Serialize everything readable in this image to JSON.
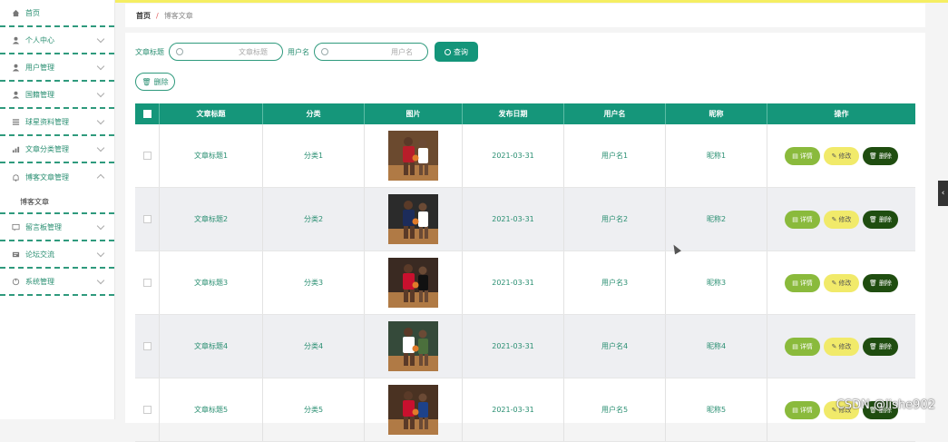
{
  "sidebar": {
    "items": [
      {
        "label": "首页",
        "icon": "home-icon",
        "expandable": false
      },
      {
        "label": "个人中心",
        "icon": "user-icon",
        "expandable": true
      },
      {
        "label": "用户管理",
        "icon": "user-icon",
        "expandable": true
      },
      {
        "label": "国籍管理",
        "icon": "user-icon",
        "expandable": true
      },
      {
        "label": "球星资料管理",
        "icon": "list-icon",
        "expandable": true
      },
      {
        "label": "文章分类管理",
        "icon": "chart-icon",
        "expandable": true
      },
      {
        "label": "博客文章管理",
        "icon": "bell-icon",
        "expandable": true,
        "expanded": true,
        "sub": "博客文章"
      },
      {
        "label": "留言板管理",
        "icon": "message-icon",
        "expandable": true
      },
      {
        "label": "论坛交流",
        "icon": "forum-icon",
        "expandable": true
      },
      {
        "label": "系统管理",
        "icon": "settings-icon",
        "expandable": true
      }
    ]
  },
  "breadcrumb": {
    "home": "首页",
    "separator": "/",
    "current": "博客文章"
  },
  "search": {
    "title_label": "文章标题",
    "title_placeholder": "文章标题",
    "user_label": "用户名",
    "user_placeholder": "用户名",
    "query_button": "查询"
  },
  "delete_button": "删除",
  "table": {
    "headers": [
      "文章标题",
      "分类",
      "图片",
      "发布日期",
      "用户名",
      "昵称",
      "操作"
    ],
    "rows": [
      {
        "title": "文章标题1",
        "category": "分类1",
        "date": "2021-03-31",
        "user": "用户名1",
        "nickname": "昵称1"
      },
      {
        "title": "文章标题2",
        "category": "分类2",
        "date": "2021-03-31",
        "user": "用户名2",
        "nickname": "昵称2"
      },
      {
        "title": "文章标题3",
        "category": "分类3",
        "date": "2021-03-31",
        "user": "用户名3",
        "nickname": "昵称3"
      },
      {
        "title": "文章标题4",
        "category": "分类4",
        "date": "2021-03-31",
        "user": "用户名4",
        "nickname": "昵称4"
      },
      {
        "title": "文章标题5",
        "category": "分类5",
        "date": "2021-03-31",
        "user": "用户名5",
        "nickname": "昵称5"
      }
    ],
    "actions": {
      "detail": "详情",
      "edit": "修改",
      "delete": "删除"
    }
  },
  "watermark": "CSDN @lishe902",
  "colors": {
    "accent": "#14957a",
    "detail": "#8aba3c",
    "edit": "#f1ea6a",
    "delete": "#1f4d10"
  }
}
